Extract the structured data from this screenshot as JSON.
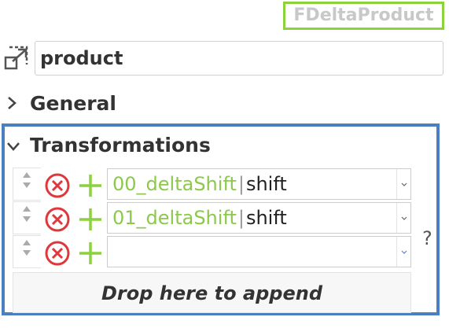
{
  "type_label": "FDeltaProduct",
  "name_field": {
    "value": "product"
  },
  "sections": {
    "general": {
      "label": "General",
      "expanded": false
    },
    "transformations": {
      "label": "Transformations",
      "expanded": true
    }
  },
  "transformations": {
    "items": [
      {
        "function": "00_deltaShift",
        "separator": "|",
        "type": "shift"
      },
      {
        "function": "01_deltaShift",
        "separator": "|",
        "type": "shift"
      },
      {
        "function": "",
        "separator": "",
        "type": ""
      }
    ],
    "help": "?",
    "drop_zone": "Drop here to append"
  },
  "colors": {
    "type_label_border": "#8cd23c",
    "section_highlight": "#4a7fc1",
    "delete_icon": "#e0373c",
    "add_icon": "#8cd23c",
    "function_text": "#8cc94a"
  },
  "icons": {
    "name": "open-in-window-icon",
    "delete": "delete-circle-x-icon",
    "add": "plus-icon",
    "grip": "sort-arrows-icon",
    "dropdown": "chevron-down-icon"
  }
}
